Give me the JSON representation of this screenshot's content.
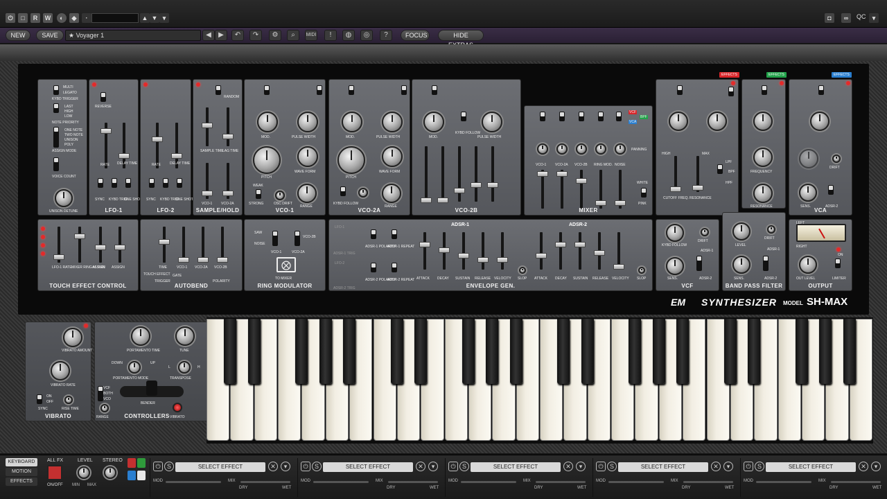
{
  "topbar": {
    "r": "R",
    "w": "W",
    "qc": "QC"
  },
  "toolbar": {
    "new": "NEW",
    "save": "SAVE",
    "preset": "Voyager 1",
    "midi": "MIDI",
    "focus": "FOCUS",
    "hide_extras": "HIDE EXTRAS"
  },
  "modules": {
    "touch": "TOUCH EFFECT CONTROL",
    "lfo1": "LFO-1",
    "lfo2": "LFO-2",
    "sh": "SAMPLE/HOLD",
    "vco1": "VCO-1",
    "vco2a": "VCO-2A",
    "vco2b": "VCO-2B",
    "mixer": "MIXER",
    "vcf": "VCF",
    "vca": "VCA",
    "autobend": "AUTOBEND",
    "ring": "RING MODULATOR",
    "envgen": "ENVELOPE GEN.",
    "bpf": "BAND PASS FILTER",
    "output": "OUTPUT"
  },
  "labels": {
    "multi": "MULTI",
    "legato": "LEGATO",
    "kybd_trigger": "KYBD TRIGGER",
    "last": "LAST",
    "high": "HIGH",
    "low": "LOW",
    "note_priority": "NOTE PRIORITY",
    "one_note": "ONE NOTE",
    "two_note": "TWO NOTE",
    "unison": "UNISON",
    "poly": "POLY",
    "assign_mode": "ASSIGN MODE",
    "voice_count": "VOICE COUNT",
    "unison_detune": "UNISON DETUNE",
    "reverse": "REVERSE",
    "random": "RANDOM",
    "rate": "RATE",
    "delay_time": "DELAY TIME",
    "sample_time": "SAMPLE TIME",
    "lag_time": "LAG TIME",
    "sync": "SYNC",
    "kybd_trig": "KYBD TRIG",
    "one_shot": "ONE SHOT",
    "vco1_s": "VCO-1",
    "vco2a_s": "VCO-2A",
    "mod": "MOD.",
    "pulse_width": "PULSE WIDTH",
    "pitch": "PITCH",
    "wave_form": "WAVE FORM",
    "range": "RANGE",
    "weak": "WEAK",
    "strong": "STRONG",
    "sync_out": "SYNC OUT",
    "osc_drift": "OSC DRIFT",
    "off": "OFF",
    "on": "ON",
    "kybd_follow": "KYBD FOLLOW",
    "adsr1": "ADSR-1",
    "adsr2": "ADSR-2",
    "manual": "MANUAL",
    "sh_s": "S/H",
    "vco2b_s": "VCO-2B",
    "ring_mod": "RING MOD.",
    "noise": "NOISE",
    "panning": "PANNING",
    "white": "WHITE",
    "pink": "PINK",
    "vcf_t": "VCF",
    "bpf_t": "BPF",
    "vca_t": "VCA",
    "high_s": "HIGH",
    "max": "MAX",
    "lpf": "LPF",
    "bpf": "BPF",
    "hpf": "HPF",
    "cutoff_freq": "CUTOFF FREQ.",
    "resonance": "RESONANCE",
    "drift": "DRIFT",
    "frequency": "FREQUENCY",
    "sens": "SENS.",
    "level": "LEVEL",
    "left": "LEFT",
    "right": "RIGHT",
    "out_level": "OUT LEVEL",
    "limiter": "LIMITER",
    "lfo1_rate": "LFO-1 RATE",
    "mixer_ring": "MIXER RING M. PAN",
    "assign": "ASSIGN",
    "time": "TIME",
    "touch_effect": "TOUCH EFFECT",
    "gate": "GATE",
    "trigger": "TRIGGER",
    "polarity": "POLARITY",
    "to_mixer": "TO MIXER",
    "lfo1_s": "LFO-1",
    "lfo2_s": "LFO-2",
    "adsr1_trig": "ADSR-1 TRIG",
    "adsr2_trig": "ADSR-2 TRIG",
    "adsr1_pol": "ADSR-1 POLARITY",
    "adsr1_rep": "ADSR-1 REPEAT",
    "adsr2_pol": "ADSR-2 POLARITY",
    "adsr2_rep": "ADSR-2 REPEAT",
    "attack": "ATTACK",
    "decay": "DECAY",
    "sustain": "SUSTAIN",
    "release": "RELEASE",
    "velocity": "VELOCITY",
    "slop": "SLOP",
    "effects": "EFFECTS",
    "saw": "SAW"
  },
  "brand": {
    "logo": "EM",
    "name": "SYNTHESIZER",
    "model_label": "MODEL",
    "model": "SH-MAX"
  },
  "left_controls": {
    "vibrato_amount": "VIBRATO AMOUNT",
    "vibrato_rate": "VIBRATO RATE",
    "on": "ON",
    "off": "OFF",
    "sync": "SYNC",
    "rise_time": "RISE TIME",
    "vibrato": "VIBRATO",
    "portamento_time": "PORTAMENTO TIME",
    "tune": "TUNE",
    "down": "DOWN",
    "l": "L",
    "up": "UP",
    "portamento_mode": "PORTAMENTO MODE",
    "h": "H",
    "transpose": "TRANSPOSE",
    "vcf": "VCF",
    "both": "BOTH",
    "vco": "VCO",
    "bender": "BENDER",
    "range": "RANGE",
    "controllers": "CONTROLLERS",
    "vibrato_btn": "VIBRATO"
  },
  "footer": {
    "tabs": [
      "KEYBOARD",
      "MOTION",
      "EFFECTS"
    ],
    "all_fx": "ALL FX",
    "on_off": "ON/OFF",
    "level": "LEVEL",
    "min": "MIN",
    "max": "MAX",
    "stereo": "STEREO",
    "slots": [
      {
        "name": "SELECT EFFECT",
        "mod": "MOD",
        "mix": "MIX",
        "dry": "DRY",
        "wet": "WET"
      },
      {
        "name": "SELECT EFFECT",
        "mod": "MOD",
        "mix": "MIX",
        "dry": "DRY",
        "wet": "WET"
      },
      {
        "name": "SELECT EFFECT",
        "mod": "MOD",
        "mix": "MIX",
        "dry": "DRY",
        "wet": "WET"
      },
      {
        "name": "SELECT EFFECT",
        "mod": "MOD",
        "mix": "MIX",
        "dry": "DRY",
        "wet": "WET"
      },
      {
        "name": "SELECT EFFECT",
        "mod": "MOD",
        "mix": "MIX",
        "dry": "DRY",
        "wet": "WET"
      }
    ]
  },
  "colors": {
    "accent_purple": "#3a2d46",
    "led_red": "#e42a2a",
    "vcf_tag": "#d9262a",
    "bpf_tag": "#22a24a",
    "vca_tag": "#2a7fd0"
  }
}
